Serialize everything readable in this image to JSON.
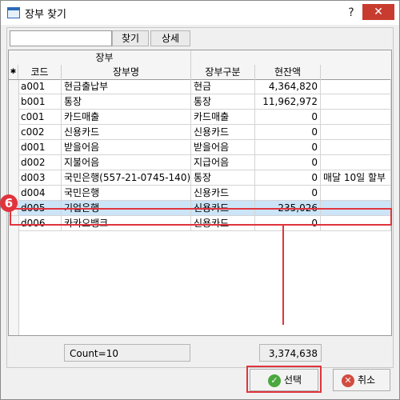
{
  "window": {
    "title": "장부 찾기",
    "help": "?",
    "close": "✕"
  },
  "search": {
    "value": "",
    "find_label": "찾기",
    "detail_label": "상세"
  },
  "table": {
    "group_header": "장부",
    "columns": [
      "코드",
      "장부명",
      "장부구분",
      "현잔액"
    ],
    "new_row_marker": "✱",
    "current_row_marker": "▶",
    "rows": [
      {
        "code": "a001",
        "name": "현금출납부",
        "type": "현금",
        "balance": "4,364,820",
        "memo": ""
      },
      {
        "code": "b001",
        "name": "통장",
        "type": "통장",
        "balance": "11,962,972",
        "memo": ""
      },
      {
        "code": "c001",
        "name": "카드매출",
        "type": "카드매출",
        "balance": "0",
        "memo": ""
      },
      {
        "code": "c002",
        "name": "신용카드",
        "type": "신용카드",
        "balance": "0",
        "memo": ""
      },
      {
        "code": "d001",
        "name": "받을어음",
        "type": "받을어음",
        "balance": "0",
        "memo": ""
      },
      {
        "code": "d002",
        "name": "지불어음",
        "type": "지급어음",
        "balance": "0",
        "memo": ""
      },
      {
        "code": "d003",
        "name": "국민은행(557-21-0745-140)",
        "type": "통장",
        "balance": "0",
        "memo": "매달 10일 할부"
      },
      {
        "code": "d004",
        "name": "국민은행",
        "type": "신용카드",
        "balance": "0",
        "memo": ""
      },
      {
        "code": "d005",
        "name": "기업은행",
        "type": "신용카드",
        "balance": "235,026",
        "memo": ""
      },
      {
        "code": "d006",
        "name": "카카오뱅크",
        "type": "신용카드",
        "balance": "0",
        "memo": ""
      }
    ],
    "selected_index": 8
  },
  "footer": {
    "count_text": "Count=10",
    "total_text": "3,374,638"
  },
  "buttons": {
    "select_label": "선택",
    "cancel_label": "취소"
  },
  "annotation": {
    "step_number": "6",
    "color": "#e0343d"
  }
}
